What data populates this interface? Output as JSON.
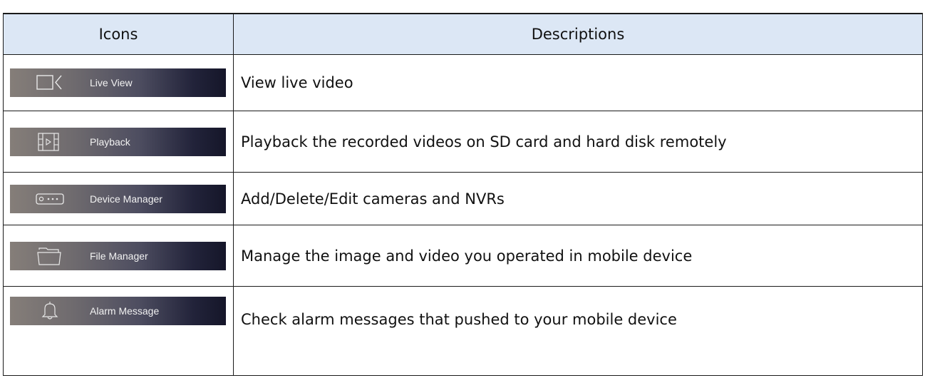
{
  "table": {
    "headers": {
      "icons": "Icons",
      "descriptions": "Descriptions"
    },
    "rows": [
      {
        "icon": "video-camera-icon",
        "button_label": "Live View",
        "description": "View live video"
      },
      {
        "icon": "film-playback-icon",
        "button_label": "Playback",
        "description": "Playback the recorded videos on SD card and hard disk remotely"
      },
      {
        "icon": "device-recorder-icon",
        "button_label": "Device Manager",
        "description": "Add/Delete/Edit cameras and NVRs"
      },
      {
        "icon": "folder-icon",
        "button_label": "File Manager",
        "description": "Manage the image and video you operated in mobile device"
      },
      {
        "icon": "bell-icon",
        "button_label": "Alarm Message",
        "description": "Check alarm messages that pushed to your mobile device"
      }
    ]
  },
  "colors": {
    "header_background": "#dce7f5",
    "button_gradient_start": "#857e79",
    "button_gradient_end": "#151629",
    "border": "#1a1a1a"
  }
}
